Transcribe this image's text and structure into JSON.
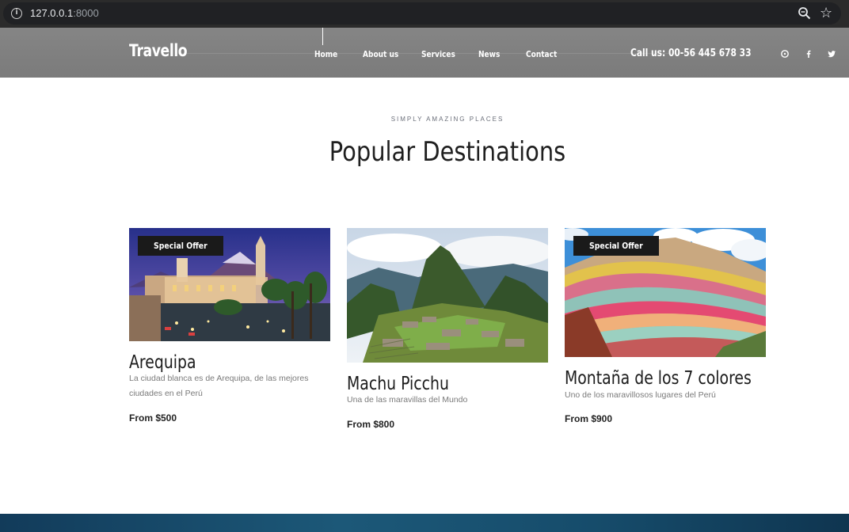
{
  "browser": {
    "url_host": "127.0.0.1",
    "url_port": ":8000"
  },
  "header": {
    "logo": "Travello",
    "nav": [
      "Home",
      "About us",
      "Services",
      "News",
      "Contact"
    ],
    "call_us": "Call us: 00-56 445 678 33",
    "social_icons": [
      "pinterest-icon",
      "facebook-icon",
      "twitter-icon"
    ]
  },
  "section": {
    "kicker": "SIMPLY AMAZING PLACES",
    "title": "Popular Destinations"
  },
  "destinations": [
    {
      "name": "Arequipa",
      "badge": "Special Offer",
      "description": "La ciudad blanca es de Arequipa, de las mejores ciudades en el Perú",
      "price": "From $500"
    },
    {
      "name": "Machu Picchu",
      "badge": "",
      "description": "Una de las maravillas del Mundo",
      "price": "From $800"
    },
    {
      "name": "Montaña de los 7 colores",
      "badge": "Special Offer",
      "description": "Uno de los maravillosos lugares del Perú",
      "price": "From $900"
    }
  ]
}
